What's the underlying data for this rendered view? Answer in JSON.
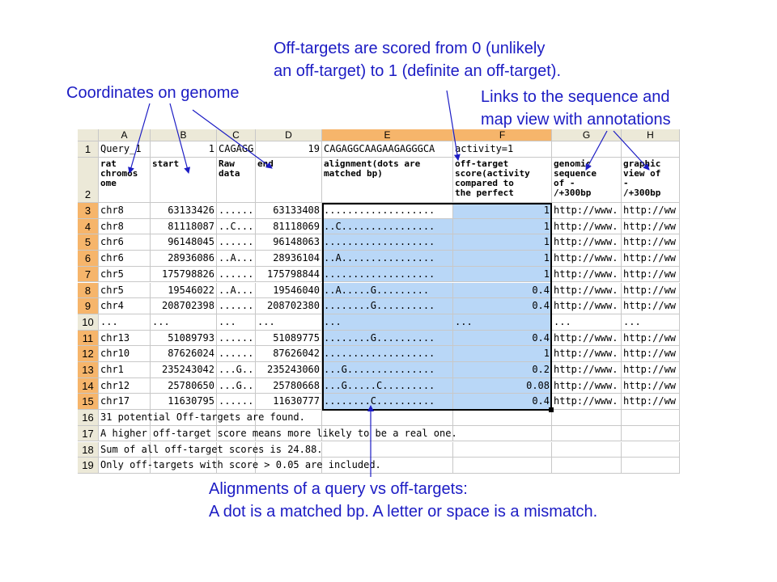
{
  "annotations": {
    "offtarget_line1": "Off-targets are scored from 0 (unlikely",
    "offtarget_line2": "an off-target) to 1 (definite an off-target).",
    "coordinates": "Coordinates on genome",
    "links_line1": "Links to the sequence and",
    "links_line2": "map view with annotations",
    "alignments_line1": "Alignments of a query vs off-targets:",
    "alignments_line2": "A dot is a matched bp. A letter or space is a mismatch."
  },
  "colors": {
    "annotation": "#1c1cc4",
    "selection": "#b9d7f7",
    "header_selected": "#f6b56b"
  },
  "spreadsheet": {
    "columns": [
      "A",
      "B",
      "C",
      "D",
      "E",
      "F",
      "G",
      "H"
    ],
    "row1": [
      "Query_1",
      "1",
      "CAGAGG",
      "19",
      "CAGAGGCAAGAAGAGGGCA",
      "activity=1",
      "",
      ""
    ],
    "row2": [
      "rat\nchromos\nome",
      "start",
      "Raw\ndata",
      "end",
      "alignment(dots are\nmatched bp)",
      "off-target\nscore(activity\ncompared to\nthe perfect",
      "genomic\nsequence\nof -\n/+300bp",
      "graphic\nview of\n-\n/+300bp"
    ],
    "rows": [
      {
        "num": "3",
        "chr": "chr8",
        "start": "63133426",
        "raw": "......",
        "end": "63133408",
        "align": "...................",
        "score": "1",
        "g": "http://www.",
        "h": "http://ww"
      },
      {
        "num": "4",
        "chr": "chr8",
        "start": "81118087",
        "raw": "..C...",
        "end": "81118069",
        "align": "..C................",
        "score": "1",
        "g": "http://www.",
        "h": "http://ww"
      },
      {
        "num": "5",
        "chr": "chr6",
        "start": "96148045",
        "raw": "......",
        "end": "96148063",
        "align": "...................",
        "score": "1",
        "g": "http://www.",
        "h": "http://ww"
      },
      {
        "num": "6",
        "chr": "chr6",
        "start": "28936086",
        "raw": "..A...",
        "end": "28936104",
        "align": "..A................",
        "score": "1",
        "g": "http://www.",
        "h": "http://ww"
      },
      {
        "num": "7",
        "chr": "chr5",
        "start": "175798826",
        "raw": "......",
        "end": "175798844",
        "align": "...................",
        "score": "1",
        "g": "http://www.",
        "h": "http://ww"
      },
      {
        "num": "8",
        "chr": "chr5",
        "start": "19546022",
        "raw": "..A...",
        "end": "19546040",
        "align": "..A.....G.........",
        "score": "0.4",
        "g": "http://www.",
        "h": "http://ww"
      },
      {
        "num": "9",
        "chr": "chr4",
        "start": "208702398",
        "raw": "......",
        "end": "208702380",
        "align": "........G..........",
        "score": "0.4",
        "g": "http://www.",
        "h": "http://ww"
      },
      {
        "num": "10",
        "chr": "...",
        "start": "...",
        "raw": "...",
        "end": "...",
        "align": "...",
        "score": "...",
        "g": "...",
        "h": "..."
      },
      {
        "num": "11",
        "chr": "chr13",
        "start": "51089793",
        "raw": "......",
        "end": "51089775",
        "align": "........G..........",
        "score": "0.4",
        "g": "http://www.",
        "h": "http://ww"
      },
      {
        "num": "12",
        "chr": "chr10",
        "start": "87626024",
        "raw": "......",
        "end": "87626042",
        "align": "...................",
        "score": "1",
        "g": "http://www.",
        "h": "http://ww"
      },
      {
        "num": "13",
        "chr": "chr1",
        "start": "235243042",
        "raw": "...G..",
        "end": "235243060",
        "align": "...G...............",
        "score": "0.2",
        "g": "http://www.",
        "h": "http://ww"
      },
      {
        "num": "14",
        "chr": "chr12",
        "start": "25780650",
        "raw": "...G..",
        "end": "25780668",
        "align": "...G.....C.........",
        "score": "0.08",
        "g": "http://www.",
        "h": "http://ww"
      },
      {
        "num": "15",
        "chr": "chr17",
        "start": "11630795",
        "raw": "......",
        "end": "11630777",
        "align": "........C..........",
        "score": "0.4",
        "g": "http://www.",
        "h": "http://ww"
      }
    ],
    "footer": [
      {
        "num": "16",
        "text": "31 potential Off-targets are found."
      },
      {
        "num": "17",
        "text": " A higher off-target score means more likely to be a real one."
      },
      {
        "num": "18",
        "text": "Sum of all off-target scores is 24.88."
      },
      {
        "num": "19",
        "text": "Only off-targets with score > 0.05 are included."
      }
    ]
  }
}
